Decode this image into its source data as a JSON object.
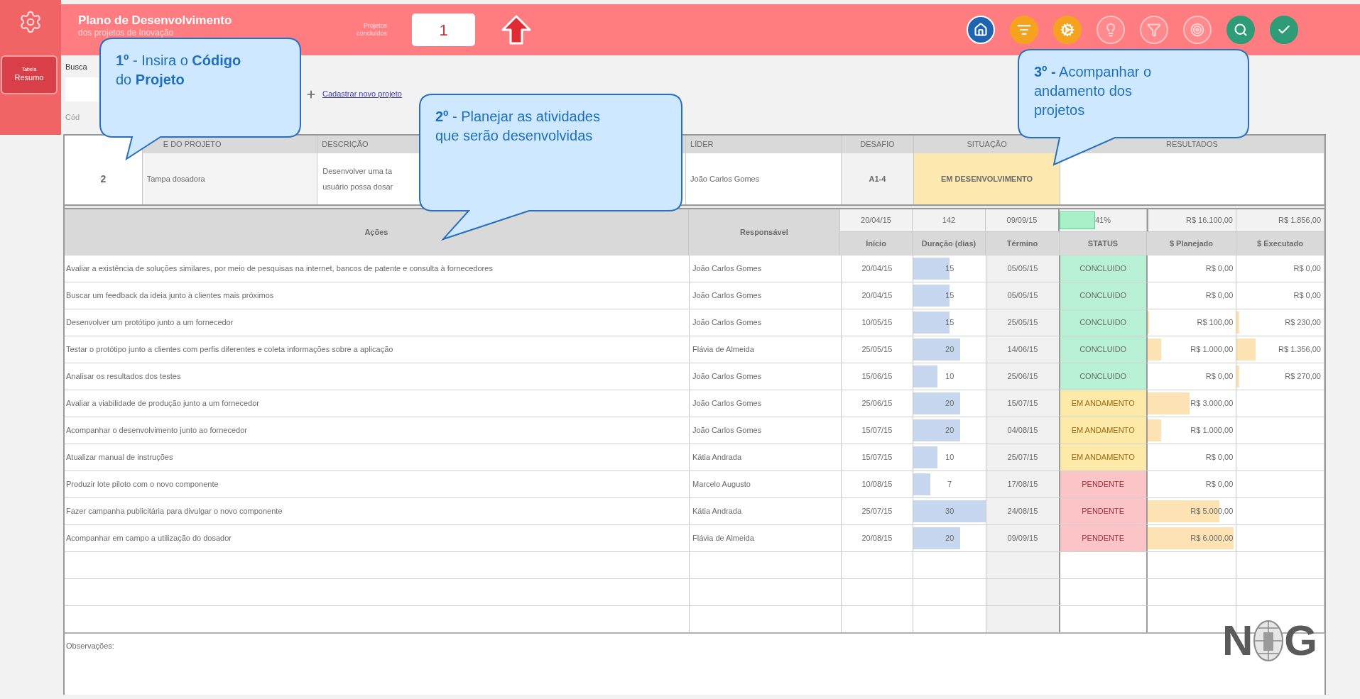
{
  "sidebar": {
    "summary_button": [
      "Tabela",
      "Resumo"
    ]
  },
  "header": {
    "title": "Plano de Desenvolvimento",
    "subtitle": "dos projetos de Inovação",
    "counter_label": [
      "Projetos",
      "concluídos"
    ],
    "counter_value": "1"
  },
  "search": {
    "label": "Busca",
    "code_label": "Cód",
    "new_project_link": "Cadastrar novo projeto"
  },
  "project": {
    "columns": [
      "E DO PROJETO",
      "DESCRIÇÃO",
      "LÍDER",
      "DESAFIO",
      "SITUAÇÃO",
      "RESULTADOS"
    ],
    "code": "2",
    "name": "Tampa dosadora",
    "description": [
      "Desenvolver uma ta",
      "usuário possa dosar"
    ],
    "leader": "João Carlos Gomes",
    "challenge": "A1-4",
    "situation": "EM DESENVOLVIMENTO"
  },
  "summary": {
    "start": "20/04/15",
    "days": "142",
    "end": "09/09/15",
    "progress": {
      "label": "41%",
      "level": 0.41
    },
    "planned": "R$ 16.100,00",
    "executed": "R$ 1.856,00"
  },
  "actions": {
    "columns": [
      "Ações",
      "Responsável",
      "Início",
      "Duração (dias)",
      "Término",
      "STATUS",
      "$ Planejado",
      "$ Executado"
    ],
    "rows": [
      {
        "action": "Avaliar a existência de soluções similares, por meio de pesquisas na internet, bancos de patente e consulta à fornecedores",
        "owner": "João Carlos Gomes",
        "start": "20/04/15",
        "days": "15",
        "level": 0.5,
        "end": "05/05/15",
        "status": {
          "kind": "done",
          "label": "CONCLUIDO"
        },
        "planned": {
          "value": "R$ 0,00"
        },
        "executed": {
          "value": "R$ 0,00"
        }
      },
      {
        "action": "Buscar um feedback da ideia junto à clientes mais próximos",
        "owner": "João Carlos Gomes",
        "start": "20/04/15",
        "days": "15",
        "level": 0.5,
        "end": "05/05/15",
        "status": {
          "kind": "done",
          "label": "CONCLUIDO"
        },
        "planned": {
          "value": "R$ 0,00"
        },
        "executed": {
          "value": "R$ 0,00"
        }
      },
      {
        "action": "Desenvolver um protótipo junto a um fornecedor",
        "owner": "João Carlos Gomes",
        "start": "10/05/15",
        "days": "15",
        "level": 0.5,
        "end": "25/05/15",
        "status": {
          "kind": "done",
          "label": "CONCLUIDO"
        },
        "planned": {
          "value": "R$ 100,00",
          "level": 0.02
        },
        "executed": {
          "value": "R$ 230,00",
          "level": 0.03
        }
      },
      {
        "action": "Testar o protótipo junto a clientes com perfis diferentes e coleta informações sobre a aplicação",
        "owner": "Flávia de Almeida",
        "start": "25/05/15",
        "days": "20",
        "level": 0.65,
        "end": "14/06/15",
        "status": {
          "kind": "done",
          "label": "CONCLUIDO"
        },
        "planned": {
          "value": "R$ 1.000,00",
          "level": 0.16
        },
        "executed": {
          "value": "R$ 1.356,00",
          "level": 0.22
        }
      },
      {
        "action": "Analisar os resultados dos testes",
        "owner": "João Carlos Gomes",
        "start": "15/06/15",
        "days": "10",
        "level": 0.33,
        "end": "25/06/15",
        "status": {
          "kind": "done",
          "label": "CONCLUIDO"
        },
        "planned": {
          "value": "R$ 0,00"
        },
        "executed": {
          "value": "R$ 270,00",
          "level": 0.03
        }
      },
      {
        "action": "Avaliar a viabilidade de produção junto a um fornecedor",
        "owner": "João Carlos Gomes",
        "start": "25/06/15",
        "days": "20",
        "level": 0.65,
        "end": "15/07/15",
        "status": {
          "kind": "progress",
          "label": "EM ANDAMENTO"
        },
        "planned": {
          "value": "R$ 3.000,00",
          "level": 0.48
        }
      },
      {
        "action": "Acompanhar o desenvolvimento junto ao fornecedor",
        "owner": "João Carlos Gomes",
        "start": "15/07/15",
        "days": "20",
        "level": 0.65,
        "end": "04/08/15",
        "status": {
          "kind": "progress",
          "label": "EM ANDAMENTO"
        },
        "planned": {
          "value": "R$ 1.000,00",
          "level": 0.16
        }
      },
      {
        "action": "Atualizar manual de instruções",
        "owner": "Kátia Andrada",
        "start": "15/07/15",
        "days": "10",
        "level": 0.33,
        "end": "25/07/15",
        "status": {
          "kind": "progress",
          "label": "EM ANDAMENTO"
        },
        "planned": {
          "value": "R$ 0,00"
        }
      },
      {
        "action": "Produzir lote piloto com o novo componente",
        "owner": "Marcelo Augusto",
        "start": "10/08/15",
        "days": "7",
        "level": 0.23,
        "end": "17/08/15",
        "status": {
          "kind": "pending",
          "label": "PENDENTE"
        },
        "planned": {
          "value": "R$ 0,00"
        }
      },
      {
        "action": "Fazer campanha publicitária para divulgar o novo componente",
        "owner": "Kátia Andrada",
        "start": "25/07/15",
        "days": "30",
        "level": 1.0,
        "end": "24/08/15",
        "status": {
          "kind": "pending",
          "label": "PENDENTE"
        },
        "planned": {
          "value": "R$ 5.000,00",
          "level": 0.81
        }
      },
      {
        "action": "Acompanhar em campo a utilização do dosador",
        "owner": "Flávia de Almeida",
        "start": "20/08/15",
        "days": "20",
        "level": 0.65,
        "end": "09/09/15",
        "status": {
          "kind": "pending",
          "label": "PENDENTE"
        },
        "planned": {
          "value": "R$ 6.000,00",
          "level": 0.97
        }
      }
    ]
  },
  "notes_label": "Observações:",
  "logo": {
    "left": "N",
    "right": "G"
  },
  "callouts": [
    {
      "text": "**1º** - Insira o **Código** do **Projeto**"
    },
    {
      "text": "**2º** - Planejar as atividades que serão desenvolvidas"
    },
    {
      "text": "**3º -**  Acompanhar o andamento dos projetos"
    }
  ]
}
